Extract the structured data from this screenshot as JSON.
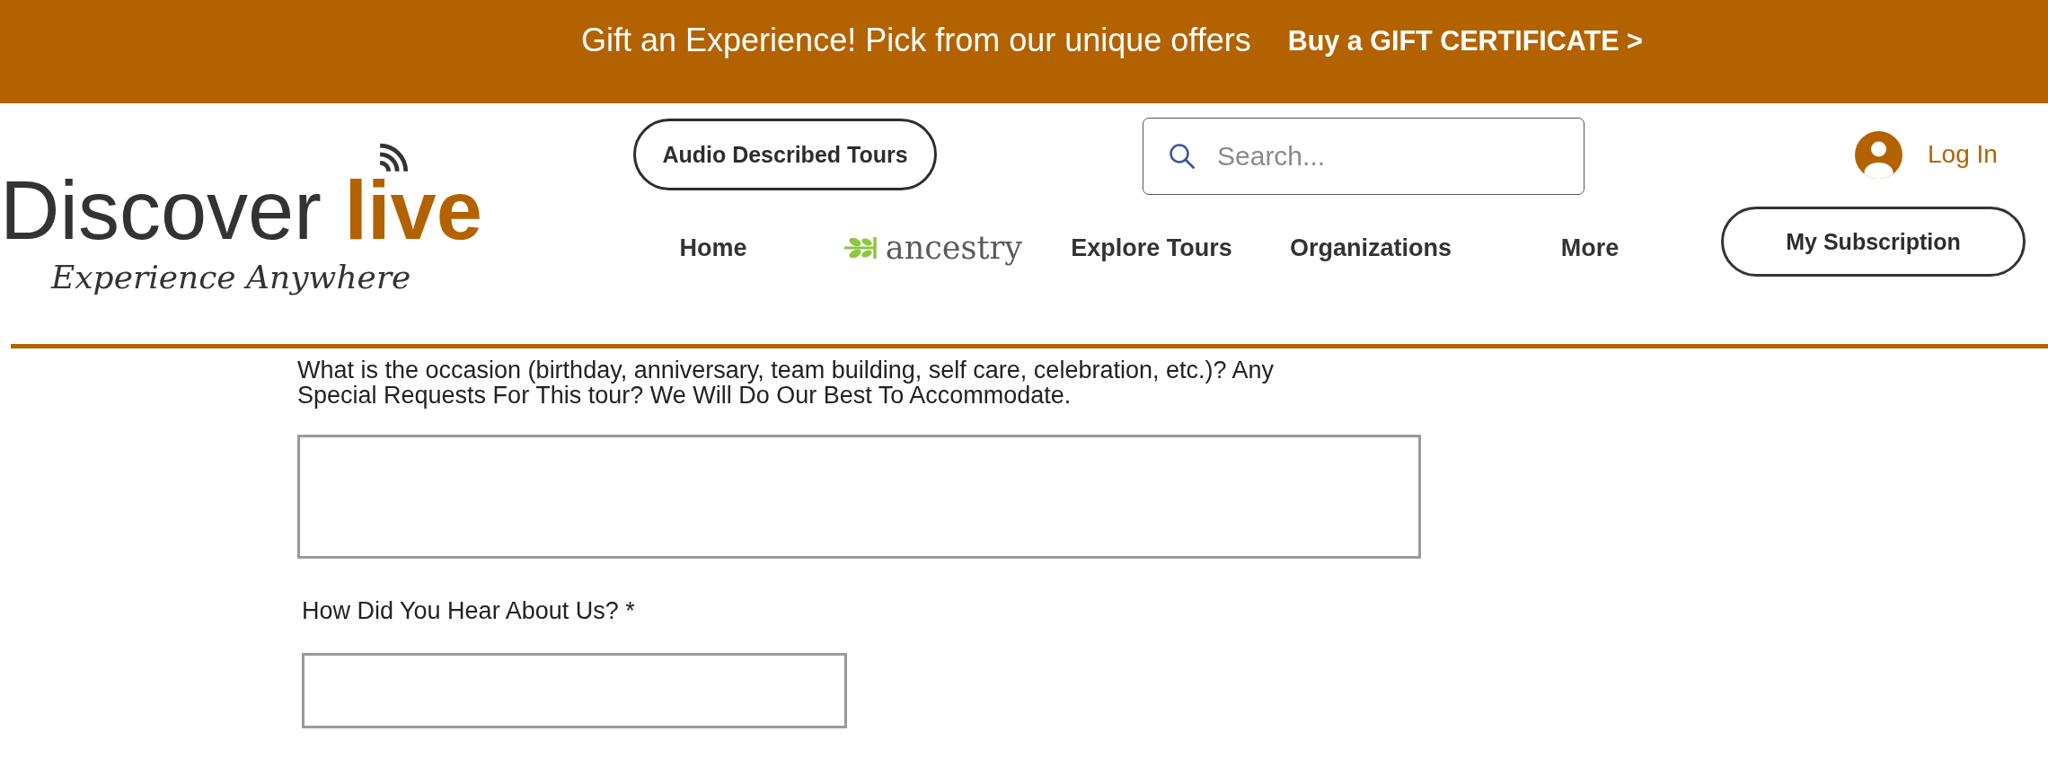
{
  "banner": {
    "message": "Gift an Experience! Pick from our unique offers",
    "link": "Buy a GIFT CERTIFICATE >"
  },
  "logo": {
    "wordmark": "Discover **live**",
    "tagline": "Experience Anywhere"
  },
  "header": {
    "audio_button": "Audio Described Tours",
    "search": {
      "placeholder": "Search..."
    },
    "login": "Log In",
    "subscription_button": "My Subscription"
  },
  "nav": {
    "items": [
      {
        "kind": "text",
        "label": "Home",
        "selected": false
      },
      {
        "kind": "logo",
        "label": "ancestry",
        "selected": false
      },
      {
        "kind": "text",
        "label": "Explore Tours",
        "selected": false
      },
      {
        "kind": "text",
        "label": "Organizations",
        "selected": false
      },
      {
        "kind": "text",
        "label": "More",
        "selected": false
      }
    ]
  },
  "form": {
    "fields": [
      {
        "kind": "textarea",
        "label": "What is the occasion (birthday, anniversary, team building, self care, celebration, etc.)? Any Special Requests For This tour? We Will Do Our Best To Accommodate."
      },
      {
        "kind": "input",
        "label": "How Did You Hear About Us? *"
      }
    ]
  }
}
